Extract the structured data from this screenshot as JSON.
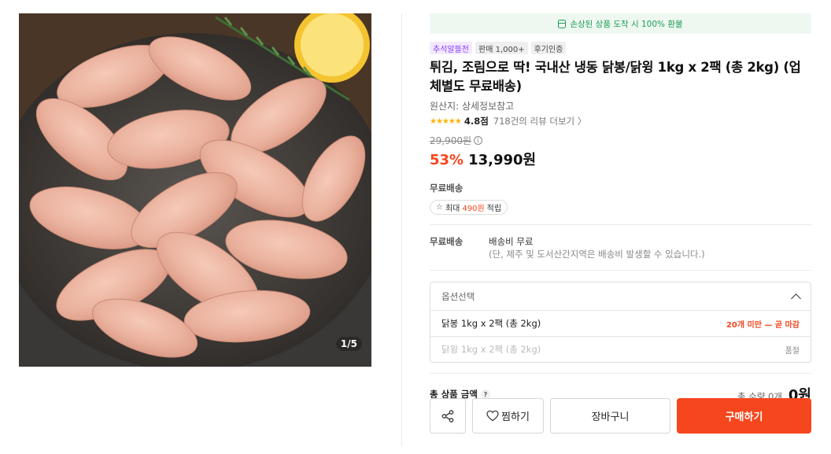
{
  "gallery": {
    "counter": "1/5"
  },
  "banner": {
    "text": "손상된 상품 도착 시 100% 환불"
  },
  "badges": [
    "추석알뜰전",
    "판매 1,000+",
    "후기인증"
  ],
  "product": {
    "title": "튀김, 조림으로 딱! 국내산 냉동 닭봉/닭윙 1kg x 2팩 (총 2kg) (업체별도 무료배송)",
    "origin": "원산지: 상세정보참고",
    "rating_stars": "★★★★★",
    "rating_score": "4.8점",
    "review_link": "718건의 리뷰 더보기 〉",
    "original_price": "29,900원",
    "discount": "53%",
    "sale_price": "13,990원"
  },
  "shipping": {
    "label": "무료배송",
    "point_prefix": "최대",
    "point_amount": "490원",
    "point_suffix": "적립"
  },
  "delivery": {
    "key": "무료배송",
    "value": "배송비 무료",
    "note": "(단, 제주 및 도서산간지역은 배송비 발생할 수 있습니다.)"
  },
  "options": {
    "header": "옵션선택",
    "items": [
      {
        "name": "닭봉 1kg x 2팩 (총 2kg)",
        "tag": "20개 미만 — 곧 마감"
      },
      {
        "name": "닭윙 1kg x 2팩 (총 2kg)",
        "tag": "품절"
      }
    ]
  },
  "total": {
    "label": "총 상품 금액",
    "help": "?",
    "qty": "총 수량 0개",
    "price": "0원"
  },
  "buttons": {
    "wish": "찜하기",
    "cart": "장바구니",
    "buy": "구매하기"
  },
  "colors": {
    "accent": "#f5461e",
    "green": "#1f9d55",
    "purple": "#8a3ffc"
  }
}
